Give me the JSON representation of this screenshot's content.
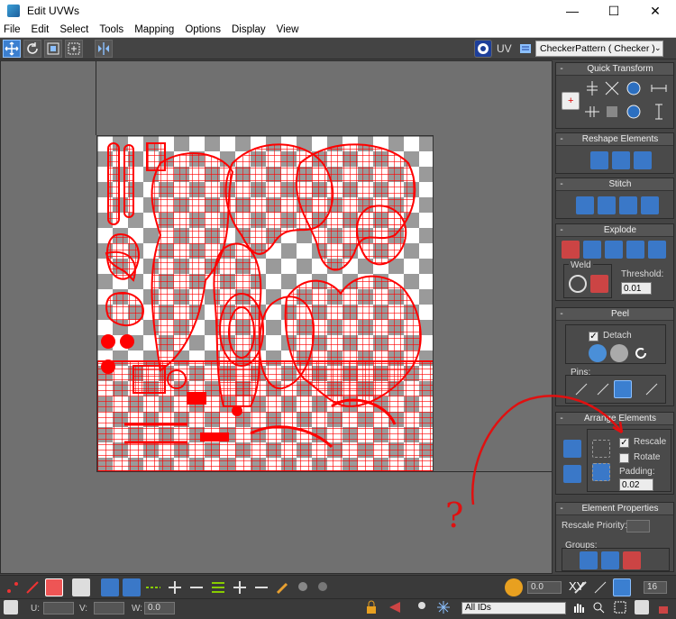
{
  "window": {
    "title": "Edit UVWs",
    "minimize": "—",
    "maximize": "☐",
    "close": "✕"
  },
  "menu": [
    "File",
    "Edit",
    "Select",
    "Tools",
    "Mapping",
    "Options",
    "Display",
    "View"
  ],
  "toolbar": {
    "uv_label": "UV",
    "checker_value": "CheckerPattern  ( Checker )"
  },
  "panels": {
    "quick_transform": {
      "title": "Quick Transform"
    },
    "reshape": {
      "title": "Reshape Elements"
    },
    "stitch": {
      "title": "Stitch"
    },
    "explode": {
      "title": "Explode",
      "weld_label": "Weld",
      "threshold_label": "Threshold:",
      "threshold_value": "0.01"
    },
    "peel": {
      "title": "Peel",
      "detach_label": "Detach",
      "detach_checked": true,
      "pins_label": "Pins:"
    },
    "arrange": {
      "title": "Arrange Elements",
      "rescale_label": "Rescale",
      "rescale_checked": true,
      "rotate_label": "Rotate",
      "rotate_checked": false,
      "padding_label": "Padding:",
      "padding_value": "0.02"
    },
    "element_properties": {
      "title": "Element Properties",
      "rescale_priority_label": "Rescale Priority:",
      "groups_label": "Groups:"
    }
  },
  "bottom": {
    "angle_value": "0.0",
    "grid_value": "16",
    "u_label": "U:",
    "v_label": "V:",
    "w_label": "W:",
    "w_value": "0.0",
    "xy_label": "XY",
    "ids_value": "All IDs"
  },
  "annotation": {
    "text": "?"
  },
  "colors": {
    "accent": "#3b7fd0",
    "uv_wire": "#ff0000",
    "annotation": "#e01010"
  }
}
